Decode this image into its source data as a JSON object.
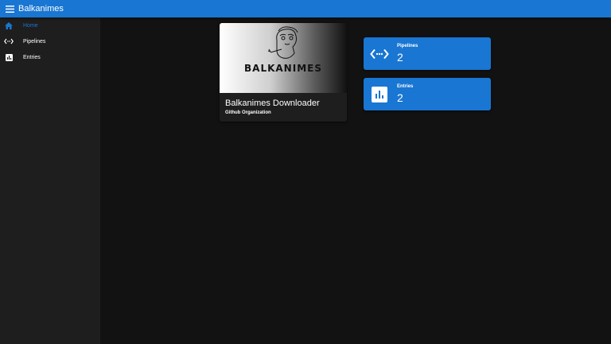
{
  "appbar": {
    "title": "Balkanimes",
    "menu_icon": "menu-icon"
  },
  "sidebar": {
    "items": [
      {
        "label": "Home",
        "icon": "home-icon",
        "active": true
      },
      {
        "label": "Pipelines",
        "icon": "code-icon",
        "active": false
      },
      {
        "label": "Entries",
        "icon": "bar-chart-icon",
        "active": false
      }
    ]
  },
  "project_card": {
    "image_text": "BALKANIMES",
    "title": "Balkanimes Downloader",
    "subtitle": "Github Organization"
  },
  "stats": [
    {
      "label": "Pipelines",
      "value": "2",
      "icon": "code-icon"
    },
    {
      "label": "Entries",
      "value": "2",
      "icon": "bar-chart-icon"
    }
  ],
  "colors": {
    "primary": "#1976d2",
    "background": "#121212",
    "surface": "#1e1e1e"
  }
}
